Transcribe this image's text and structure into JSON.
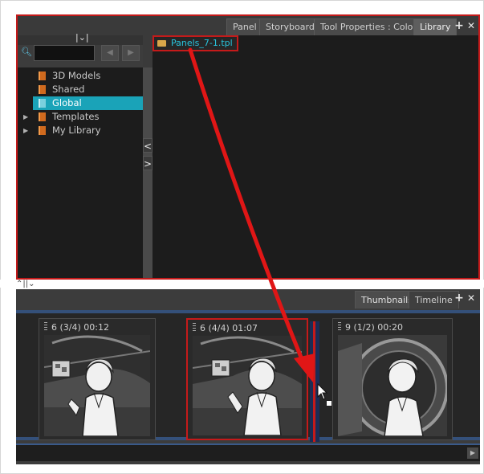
{
  "library_window": {
    "tabs": [
      {
        "label": "Panel"
      },
      {
        "label": "Storyboard"
      },
      {
        "label": "Tool Properties : Colour"
      },
      {
        "label": "Library",
        "active": true
      }
    ],
    "add_icon": "+",
    "close_icon": "✕",
    "collapse_glyph": "⌄",
    "tree": [
      {
        "label": "3D Models",
        "icon": "library-book-icon"
      },
      {
        "label": "Shared",
        "icon": "library-book-icon"
      },
      {
        "label": "Global",
        "icon": "library-book-icon",
        "selected": true
      },
      {
        "label": "Templates",
        "icon": "library-book-icon",
        "expandable": true
      },
      {
        "label": "My Library",
        "icon": "library-book-icon",
        "expandable": true
      }
    ],
    "splitter_left": "<",
    "splitter_right": ">",
    "content_items": [
      {
        "label": "Panels_7-1.tpl",
        "icon": "folder-icon"
      }
    ]
  },
  "thumbnails_window": {
    "tabs": [
      {
        "label": "Thumbnails",
        "active": true
      },
      {
        "label": "Timeline"
      }
    ],
    "add_icon": "+",
    "close_icon": "✕",
    "panels": [
      {
        "title": "6 (3/4) 00:12"
      },
      {
        "title": "6 (4/4) 01:07",
        "selected": true
      },
      {
        "title": "9 (1/2) 00:20"
      }
    ]
  },
  "colors": {
    "accent_red": "#c51a1a",
    "selection_cyan": "#1aa3b8",
    "file_text": "#29c3dc",
    "panel_bg": "#1c1c1c"
  }
}
